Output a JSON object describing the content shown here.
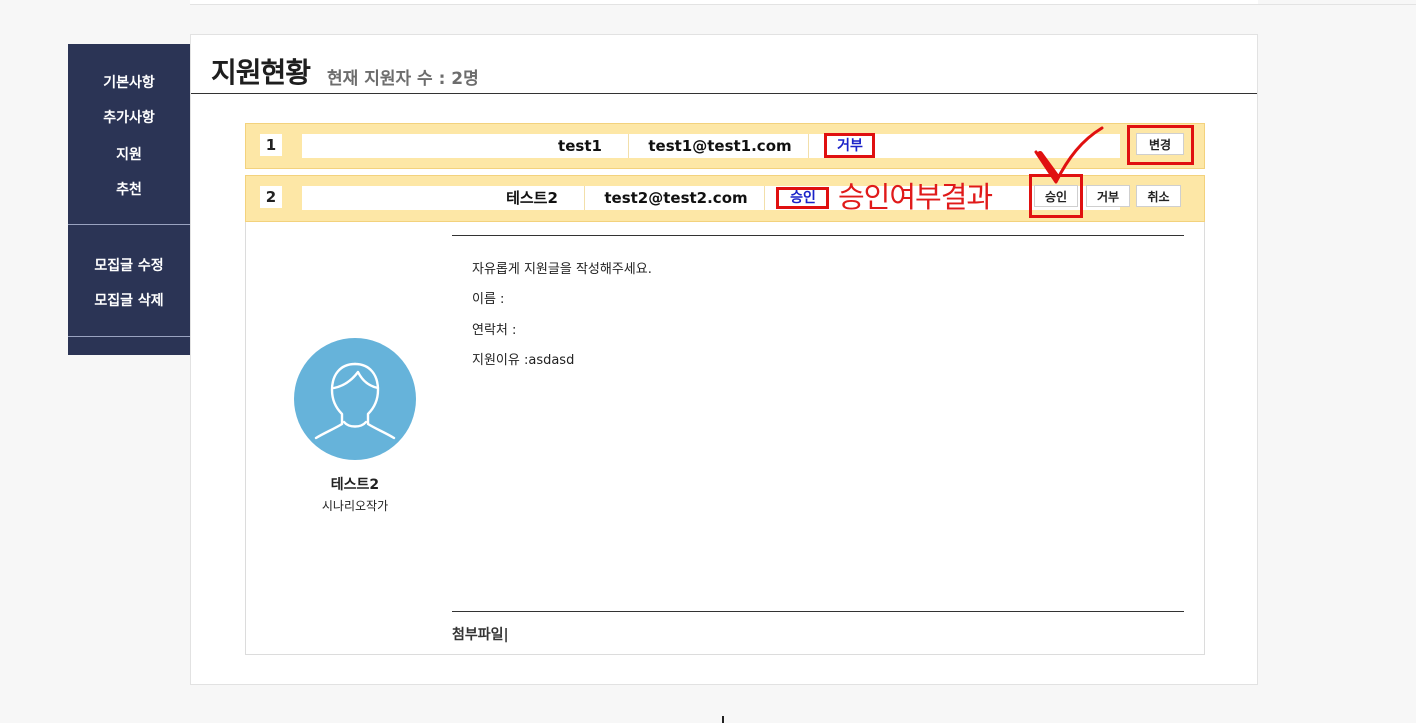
{
  "sidebar": {
    "items": [
      "기본사항",
      "추가사항",
      "지원",
      "추천"
    ],
    "actions": [
      "모집글 수정",
      "모집글 삭제"
    ]
  },
  "page": {
    "title": "지원현황",
    "subtitle": "현재 지원자 수 : 2명"
  },
  "applicants": [
    {
      "no": "1",
      "name": "test1",
      "email": "test1@test1.com",
      "status": "거부",
      "buttons": [
        "변경"
      ]
    },
    {
      "no": "2",
      "name": "테스트2",
      "email": "test2@test2.com",
      "status": "승인",
      "buttons": [
        "승인",
        "거부",
        "취소"
      ]
    }
  ],
  "annotation": {
    "text": "승인여부결과",
    "color": "#e01a1a"
  },
  "detail": {
    "profile_name": "테스트2",
    "profile_role": "시나리오작가",
    "lines": [
      "자유롭게 지원글을 작성해주세요.",
      "이름 :",
      "연락처 :",
      "지원이유 :asdasd"
    ],
    "attachment_label": "첨부파일|"
  },
  "colors": {
    "sidebar_bg": "#2b3455",
    "row_bg": "#fde7a6",
    "status_text": "#1a22c8",
    "highlight": "#e01010",
    "avatar": "#66b3da"
  }
}
